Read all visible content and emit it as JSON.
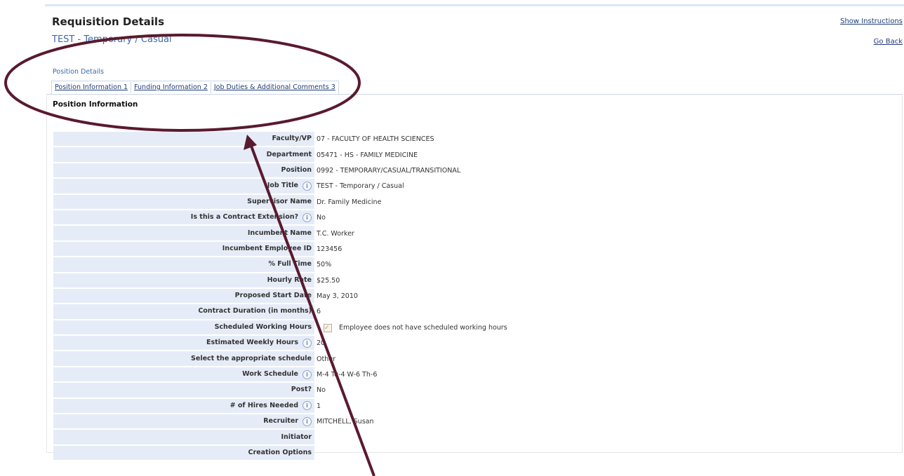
{
  "header": {
    "title": "Requisition Details",
    "subtitle": "TEST - Temporary / Casual",
    "show_instructions": "Show Instructions",
    "go_back": "Go Back"
  },
  "position_details_label": "Position Details",
  "tabs": [
    {
      "label": "Position Information 1"
    },
    {
      "label": "Funding Information 2"
    },
    {
      "label": "Job Duties & Additional Comments 3"
    }
  ],
  "section_heading": "Position Information",
  "fields": [
    {
      "label": "Faculty/VP",
      "value": "07 - FACULTY OF HEALTH SCIENCES"
    },
    {
      "label": "Department",
      "value": "05471 - HS - FAMILY MEDICINE"
    },
    {
      "label": "Position",
      "value": "0992 - TEMPORARY/CASUAL/TRANSITIONAL"
    },
    {
      "label": "Job Title",
      "value": "TEST - Temporary / Casual"
    },
    {
      "label": "Supervisor Name",
      "value": "Dr. Family Medicine"
    },
    {
      "label": "Is this a Contract Extension?",
      "value": "No"
    },
    {
      "label": "Incumbent Name",
      "value": "T.C. Worker"
    },
    {
      "label": "Incumbent Employee ID",
      "value": "123456"
    },
    {
      "label": "% Full Time",
      "value": "50%"
    },
    {
      "label": "Hourly Rate",
      "value": "$25.50"
    },
    {
      "label": "Proposed Start Date",
      "value": "May 3, 2010"
    },
    {
      "label": "Contract Duration (in months)",
      "value": "6"
    },
    {
      "label": "Scheduled Working Hours",
      "value": "Employee does not have scheduled working hours"
    },
    {
      "label": "Estimated Weekly Hours",
      "value": "20"
    },
    {
      "label": "Select the appropriate schedule",
      "value": "Other"
    },
    {
      "label": "Work Schedule",
      "value": "M-4 Tu-4 W-6 Th-6"
    },
    {
      "label": "Post?",
      "value": "No"
    },
    {
      "label": "# of Hires Needed",
      "value": "1"
    },
    {
      "label": "Recruiter",
      "value": "MITCHELL, Susan"
    },
    {
      "label": "Initiator",
      "value": ""
    },
    {
      "label": "Creation Options",
      "value": ""
    }
  ],
  "info_icon_glyph": "i",
  "colors": {
    "annotation": "#5a1a2e",
    "label_bg": "#e6ecf7",
    "link": "#1f3c78",
    "subtitle": "#3a6aa8"
  }
}
